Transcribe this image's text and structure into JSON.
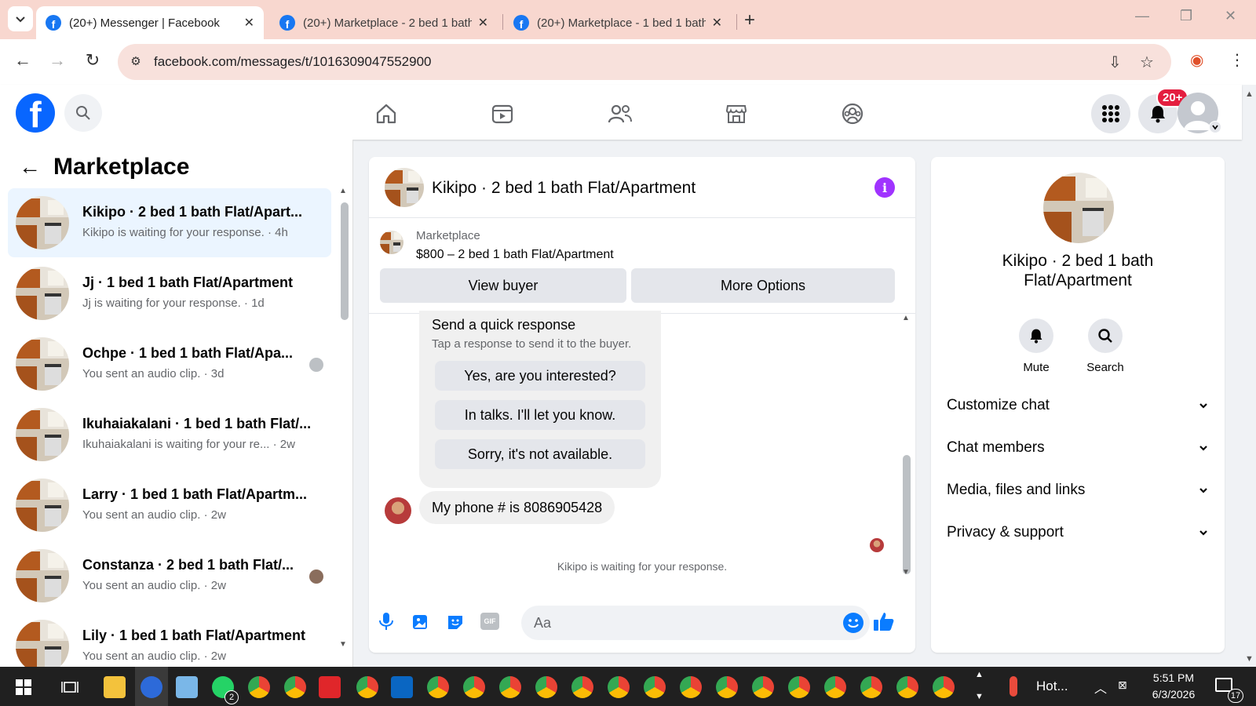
{
  "browser": {
    "tabs": [
      {
        "title": "(20+) Messenger | Facebook",
        "active": true
      },
      {
        "title": "(20+) Marketplace - 2 bed 1 bath",
        "active": false
      },
      {
        "title": "(20+) Marketplace - 1 bed 1 bath",
        "active": false
      }
    ],
    "url": "facebook.com/messages/t/1016309047552900"
  },
  "fbnav": {
    "notification_badge": "20+"
  },
  "left": {
    "title": "Marketplace",
    "conversations": [
      {
        "name": "Kikipo · 2 bed 1 bath Flat/Apart...",
        "preview": "Kikipo is waiting for your response. · 4h",
        "active": true
      },
      {
        "name": "Jj · 1 bed 1 bath Flat/Apartment",
        "preview": "Jj is waiting for your response. · 1d"
      },
      {
        "name": "Ochpe · 1 bed 1 bath Flat/Apa...",
        "preview": "You sent an audio clip. · 3d"
      },
      {
        "name": "Ikuhaiakalani · 1 bed 1 bath Flat/...",
        "preview": "Ikuhaiakalani is waiting for your re... · 2w"
      },
      {
        "name": "Larry · 1 bed 1 bath Flat/Apartm...",
        "preview": "You sent an audio clip. · 2w"
      },
      {
        "name": "Constanza · 2 bed 1 bath Flat/...",
        "preview": "You sent an audio clip. · 2w"
      },
      {
        "name": "Lily · 1 bed 1 bath Flat/Apartment",
        "preview": "You sent an audio clip. · 2w"
      }
    ]
  },
  "chat": {
    "title": "Kikipo · 2 bed 1 bath Flat/Apartment",
    "marketplace_label": "Marketplace",
    "listing": "$800 – 2 bed 1 bath Flat/Apartment",
    "view_buyer": "View buyer",
    "more_options": "More Options",
    "quick_response_title": "Send a quick response",
    "quick_response_sub": "Tap a response to send it to the buyer.",
    "quick_responses": [
      "Yes, are you interested?",
      "In talks. I'll let you know.",
      "Sorry, it's not available."
    ],
    "message": "My phone # is 8086905428",
    "waiting": "Kikipo is waiting for your response.",
    "composer_placeholder": "Aa",
    "gif_label": "GIF"
  },
  "right": {
    "name": "Kikipo · 2 bed 1 bath Flat/Apartment",
    "mute": "Mute",
    "search": "Search",
    "sections": [
      "Customize chat",
      "Chat members",
      "Media, files and links",
      "Privacy & support"
    ]
  },
  "taskbar": {
    "weather": "Hot...",
    "time": "5:51 PM",
    "date": "6/3/2026",
    "notifications": "17",
    "whatsapp_count": "2"
  }
}
